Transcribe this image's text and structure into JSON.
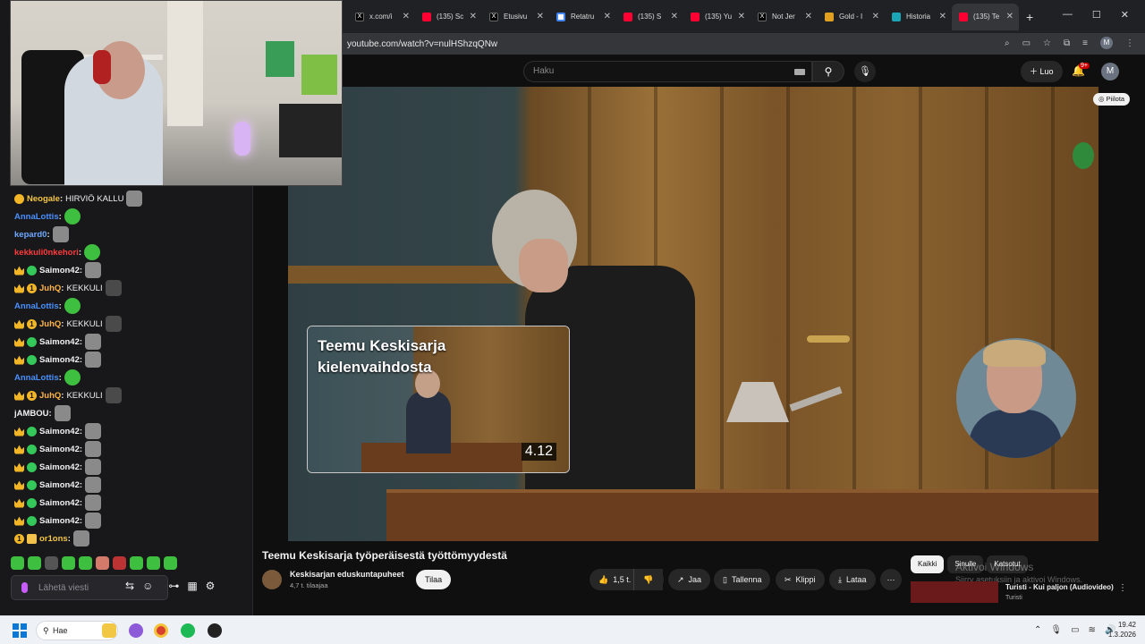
{
  "browser": {
    "tabs": [
      {
        "label": "x.com/i",
        "icon": "x-icon"
      },
      {
        "label": "(135) Sc",
        "icon": "youtube-icon"
      },
      {
        "label": "Etusivu",
        "icon": "x-icon"
      },
      {
        "label": "Retatru",
        "icon": "google-icon"
      },
      {
        "label": "(135) S",
        "icon": "youtube-icon"
      },
      {
        "label": "(135) Yu",
        "icon": "youtube-icon"
      },
      {
        "label": "Not Jer",
        "icon": "x-icon"
      },
      {
        "label": "Gold - I",
        "icon": "gold-icon"
      },
      {
        "label": "Historia",
        "icon": "history-icon"
      },
      {
        "label": "(135) Te",
        "icon": "youtube-icon",
        "active": true
      }
    ],
    "url": "youtube.com/watch?v=nulHShzqQNw",
    "profile_initial": "M"
  },
  "youtube": {
    "search_placeholder": "Haku",
    "create_label": "Luo",
    "notifications": "9+",
    "avatar_initial": "M",
    "hide_label": "Piilota",
    "endcard": {
      "title": "Teemu Keskisarja kielenvaihdosta",
      "duration": "4.12"
    },
    "video_title": "Teemu Keskisarja työperäisestä työttömyydestä",
    "channel": {
      "name": "Keskisarjan eduskuntapuheet",
      "subscribers": "4,7 t. tilaajaa",
      "subscribe_label": "Tilaa"
    },
    "actions": {
      "likes": "1,5 t.",
      "share": "Jaa",
      "save": "Tallenna",
      "clip": "Klippi",
      "download": "Lataa"
    },
    "chips": [
      "Kaikki",
      "Sinulle",
      "Katsotut"
    ],
    "recommendation": {
      "title": "Turisti - Kui paljon (Audiovideo)",
      "channel": "Turisti"
    },
    "watermark": {
      "line1": "Aktivoi Windows",
      "line2": "Siirry asetuksiin ja aktivoi Windows."
    }
  },
  "chat": {
    "messages": [
      {
        "badges": [
          "gold"
        ],
        "user": "Neogale",
        "color": "#f4c542",
        "text": "HIRVIÖ KALLU",
        "emote": "cat"
      },
      {
        "badges": [],
        "user": "AnnaLottis",
        "color": "#4a90ff",
        "text": "",
        "emote": "pepe"
      },
      {
        "badges": [],
        "user": "kepard0",
        "color": "#6ea8ff",
        "text": "",
        "emote": "cat"
      },
      {
        "badges": [],
        "user": "kekkuli0nkehori",
        "color": "#ff3b3b",
        "text": "",
        "emote": "pepe"
      },
      {
        "badges": [
          "crown",
          "green"
        ],
        "user": "Saimon42",
        "color": "#f1f1f1",
        "text": "",
        "emote": "cat"
      },
      {
        "badges": [
          "crown",
          "gold-1"
        ],
        "user": "JuhQ",
        "color": "#ffb347",
        "text": "KEKKULI",
        "emote": "dark"
      },
      {
        "badges": [],
        "user": "AnnaLottis",
        "color": "#4a90ff",
        "text": "",
        "emote": "pepe"
      },
      {
        "badges": [
          "crown",
          "gold-1"
        ],
        "user": "JuhQ",
        "color": "#ffb347",
        "text": "KEKKULI",
        "emote": "dark"
      },
      {
        "badges": [
          "crown",
          "green"
        ],
        "user": "Saimon42",
        "color": "#f1f1f1",
        "text": "",
        "emote": "cat"
      },
      {
        "badges": [
          "crown",
          "green"
        ],
        "user": "Saimon42",
        "color": "#f1f1f1",
        "text": "",
        "emote": "cat"
      },
      {
        "badges": [],
        "user": "AnnaLottis",
        "color": "#4a90ff",
        "text": "",
        "emote": "pepe"
      },
      {
        "badges": [
          "crown",
          "gold-1"
        ],
        "user": "JuhQ",
        "color": "#ffb347",
        "text": "KEKKULI",
        "emote": "dark"
      },
      {
        "badges": [],
        "user": "jAMBOU",
        "color": "#f1f1f1",
        "text": "",
        "emote": "cat"
      },
      {
        "badges": [
          "crown",
          "green"
        ],
        "user": "Saimon42",
        "color": "#f1f1f1",
        "text": "",
        "emote": "cat"
      },
      {
        "badges": [
          "crown",
          "green"
        ],
        "user": "Saimon42",
        "color": "#f1f1f1",
        "text": "",
        "emote": "cat"
      },
      {
        "badges": [
          "crown",
          "green"
        ],
        "user": "Saimon42",
        "color": "#f1f1f1",
        "text": "",
        "emote": "cat"
      },
      {
        "badges": [
          "crown",
          "green"
        ],
        "user": "Saimon42",
        "color": "#f1f1f1",
        "text": "",
        "emote": "cat"
      },
      {
        "badges": [
          "crown",
          "green"
        ],
        "user": "Saimon42",
        "color": "#f1f1f1",
        "text": "",
        "emote": "cat"
      },
      {
        "badges": [
          "crown",
          "green"
        ],
        "user": "Saimon42",
        "color": "#f1f1f1",
        "text": "",
        "emote": "cat"
      },
      {
        "badges": [
          "gold-1",
          "gift"
        ],
        "user": "or1ons",
        "color": "#f4c542",
        "text": "",
        "emote": "cat"
      }
    ],
    "input_placeholder": "Lähetä viesti"
  },
  "taskbar": {
    "search_label": "Hae",
    "time": "19.42",
    "date": "1.3.2026"
  }
}
